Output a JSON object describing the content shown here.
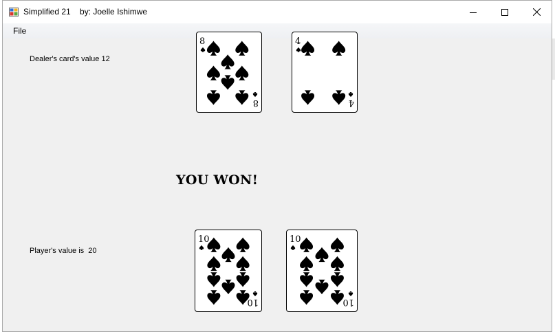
{
  "window": {
    "title": "Simplified 21    by: Joelle Ishimwe",
    "menu": {
      "file": "File"
    }
  },
  "dealer": {
    "label": "Dealer's card's value 12",
    "cards": [
      {
        "rank": "8",
        "suit": "spades"
      },
      {
        "rank": "4",
        "suit": "spades"
      }
    ]
  },
  "result": "YOU WON!",
  "player": {
    "label": "Player's value is  20",
    "cards": [
      {
        "rank": "10",
        "suit": "spades"
      },
      {
        "rank": "10",
        "suit": "spades"
      }
    ]
  },
  "icons": {
    "app": "app-icon",
    "minimize": "minimize-icon",
    "maximize": "maximize-icon",
    "close": "close-icon",
    "suit": "spade-icon"
  }
}
